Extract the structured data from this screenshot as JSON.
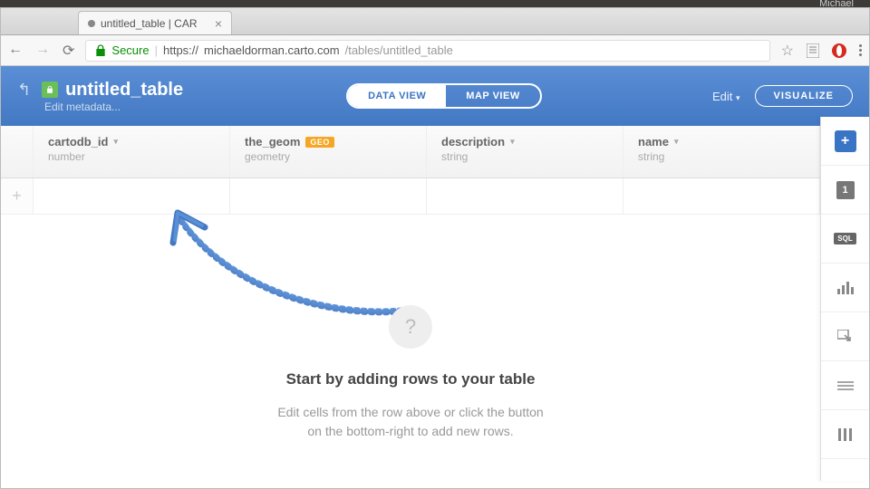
{
  "desktop": {
    "user": "Michael"
  },
  "browser": {
    "tab_title": "untitled_table | CAR",
    "secure_label": "Secure",
    "url_scheme": "https://",
    "url_host": "michaeldorman.carto.com",
    "url_path": "/tables/untitled_table"
  },
  "header": {
    "title": "untitled_table",
    "edit_metadata": "Edit metadata...",
    "data_view": "DATA VIEW",
    "map_view": "MAP VIEW",
    "edit_label": "Edit",
    "visualize": "VISUALIZE"
  },
  "columns": [
    {
      "name": "cartodb_id",
      "type": "number",
      "geo": false
    },
    {
      "name": "the_geom",
      "type": "geometry",
      "geo": true,
      "geo_label": "GEO"
    },
    {
      "name": "description",
      "type": "string",
      "geo": false
    },
    {
      "name": "name",
      "type": "string",
      "geo": false
    }
  ],
  "empty_state": {
    "title": "Start by adding rows to your table",
    "line1": "Edit cells from the row above or click the button",
    "line2": "on the bottom-right to add new rows."
  },
  "rail": {
    "page_num": "1",
    "sql": "SQL"
  }
}
